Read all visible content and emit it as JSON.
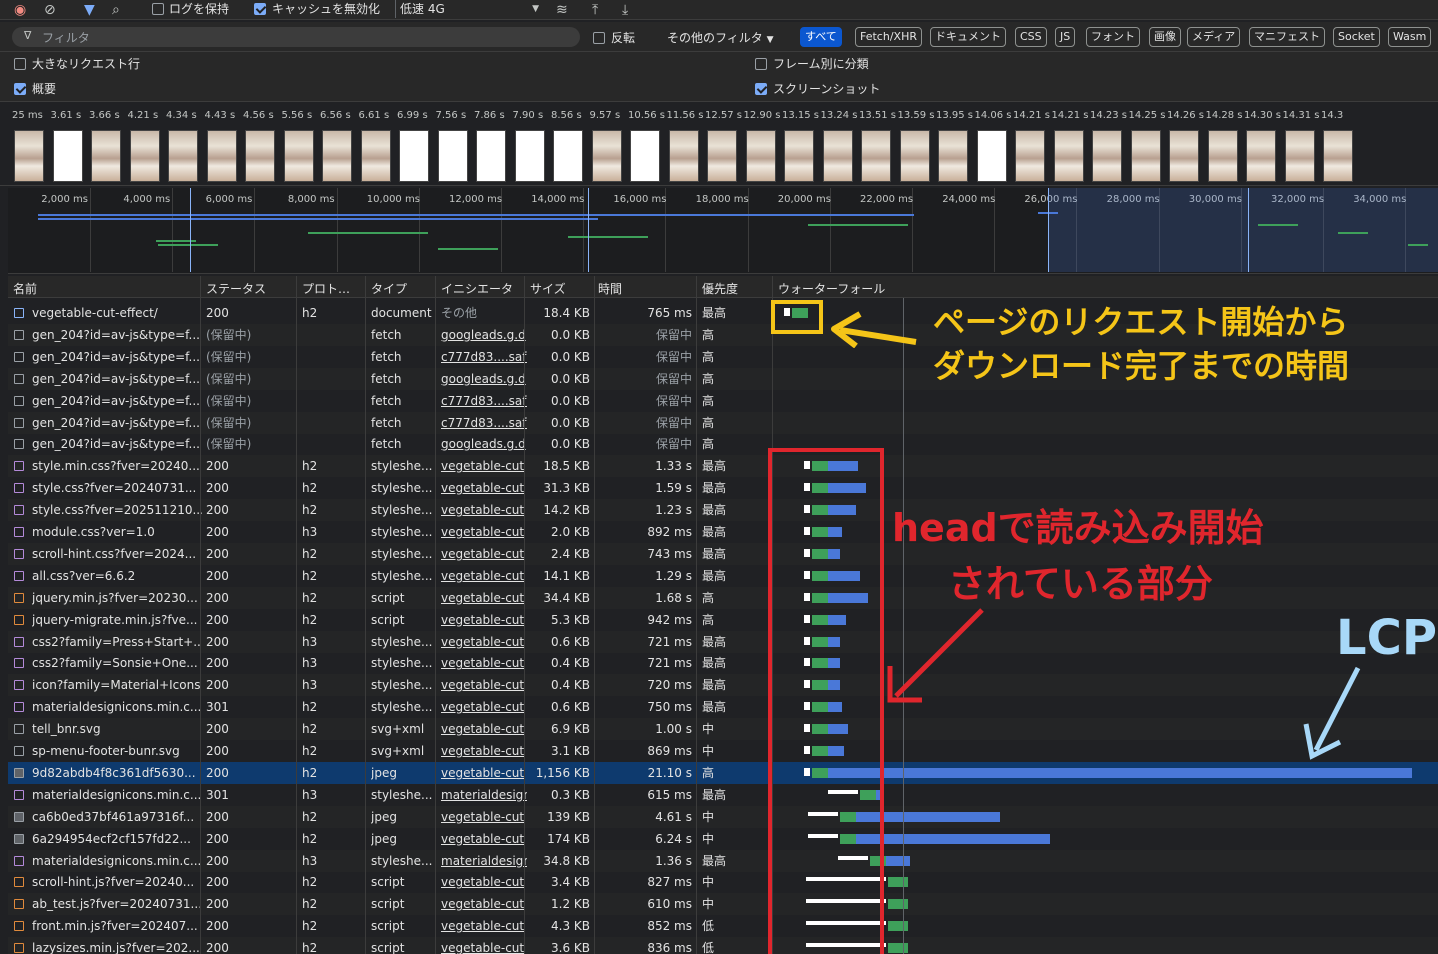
{
  "toolbar": {
    "preserve_log_label": "ログを保持",
    "disable_cache_label": "キャッシュを無効化",
    "throttle_value": "低速 4G"
  },
  "filterbar": {
    "placeholder": "フィルタ",
    "invert_label": "反転",
    "more_filters_label": "その他のフィルタ",
    "types": [
      "すべて",
      "Fetch/XHR",
      "ドキュメント",
      "CSS",
      "JS",
      "フォント",
      "画像",
      "メディア",
      "マニフェスト",
      "Socket",
      "Wasm"
    ]
  },
  "options": {
    "large_rows": "大きなリクエスト行",
    "group_by_frame": "フレーム別に分類",
    "overview": "概要",
    "screenshots": "スクリーンショット"
  },
  "filmstrip_times": [
    "25 ms",
    "3.61 s",
    "3.66 s",
    "4.21 s",
    "4.34 s",
    "4.43 s",
    "4.56 s",
    "5.56 s",
    "6.56 s",
    "6.61 s",
    "6.99 s",
    "7.56 s",
    "7.86 s",
    "7.90 s",
    "8.56 s",
    "9.57 s",
    "10.56 s",
    "11.56 s",
    "12.57 s",
    "12.90 s",
    "13.15 s",
    "13.24 s",
    "13.51 s",
    "13.59 s",
    "13.95 s",
    "14.06 s",
    "14.21 s",
    "14.21 s",
    "14.23 s",
    "14.25 s",
    "14.26 s",
    "14.28 s",
    "14.30 s",
    "14.31 s",
    "14.3"
  ],
  "overview_ticks": [
    "2,000 ms",
    "4,000 ms",
    "6,000 ms",
    "8,000 ms",
    "10,000 ms",
    "12,000 ms",
    "14,000 ms",
    "16,000 ms",
    "18,000 ms",
    "20,000 ms",
    "22,000 ms",
    "24,000 ms",
    "26,000 ms",
    "28,000 ms",
    "30,000 ms",
    "32,000 ms",
    "34,000 ms"
  ],
  "columns": {
    "name": "名前",
    "status": "ステータス",
    "protocol": "プロト…",
    "type": "タイプ",
    "initiator": "イニシエータ",
    "size": "サイズ",
    "time": "時間",
    "priority": "優先度",
    "waterfall": "ウォーターフォール"
  },
  "rows": [
    {
      "name": "vegetable-cut-effect/",
      "status": "200",
      "protocol": "h2",
      "type": "document",
      "initiator": "その他",
      "size": "18.4 KB",
      "time": "765 ms",
      "priority": "最高",
      "icon": "doc"
    },
    {
      "name": "gen_204?id=av-js&type=f...",
      "status": "(保留中)",
      "protocol": "",
      "type": "fetch",
      "initiator": "googleads.g.d",
      "size": "0.0 KB",
      "time": "保留中",
      "priority": "高",
      "icon": "file"
    },
    {
      "name": "gen_204?id=av-js&type=f...",
      "status": "(保留中)",
      "protocol": "",
      "type": "fetch",
      "initiator": "c777d83....safe",
      "size": "0.0 KB",
      "time": "保留中",
      "priority": "高",
      "icon": "file"
    },
    {
      "name": "gen_204?id=av-js&type=f...",
      "status": "(保留中)",
      "protocol": "",
      "type": "fetch",
      "initiator": "googleads.g.d",
      "size": "0.0 KB",
      "time": "保留中",
      "priority": "高",
      "icon": "file"
    },
    {
      "name": "gen_204?id=av-js&type=f...",
      "status": "(保留中)",
      "protocol": "",
      "type": "fetch",
      "initiator": "c777d83....safe",
      "size": "0.0 KB",
      "time": "保留中",
      "priority": "高",
      "icon": "file"
    },
    {
      "name": "gen_204?id=av-js&type=f...",
      "status": "(保留中)",
      "protocol": "",
      "type": "fetch",
      "initiator": "c777d83....safe",
      "size": "0.0 KB",
      "time": "保留中",
      "priority": "高",
      "icon": "file"
    },
    {
      "name": "gen_204?id=av-js&type=f...",
      "status": "(保留中)",
      "protocol": "",
      "type": "fetch",
      "initiator": "googleads.g.d",
      "size": "0.0 KB",
      "time": "保留中",
      "priority": "高",
      "icon": "file"
    },
    {
      "name": "style.min.css?fver=20240...",
      "status": "200",
      "protocol": "h2",
      "type": "styleshe...",
      "initiator": "vegetable-cut",
      "size": "18.5 KB",
      "time": "1.33 s",
      "priority": "最高",
      "icon": "css"
    },
    {
      "name": "style.css?fver=20240731...",
      "status": "200",
      "protocol": "h2",
      "type": "styleshe...",
      "initiator": "vegetable-cut",
      "size": "31.3 KB",
      "time": "1.59 s",
      "priority": "最高",
      "icon": "css"
    },
    {
      "name": "style.css?fver=202511210...",
      "status": "200",
      "protocol": "h2",
      "type": "styleshe...",
      "initiator": "vegetable-cut",
      "size": "14.2 KB",
      "time": "1.23 s",
      "priority": "最高",
      "icon": "css"
    },
    {
      "name": "module.css?ver=1.0",
      "status": "200",
      "protocol": "h3",
      "type": "styleshe...",
      "initiator": "vegetable-cut",
      "size": "2.0 KB",
      "time": "892 ms",
      "priority": "最高",
      "icon": "css"
    },
    {
      "name": "scroll-hint.css?fver=2024...",
      "status": "200",
      "protocol": "h2",
      "type": "styleshe...",
      "initiator": "vegetable-cut",
      "size": "2.4 KB",
      "time": "743 ms",
      "priority": "最高",
      "icon": "css"
    },
    {
      "name": "all.css?ver=6.6.2",
      "status": "200",
      "protocol": "h2",
      "type": "styleshe...",
      "initiator": "vegetable-cut",
      "size": "14.1 KB",
      "time": "1.29 s",
      "priority": "最高",
      "icon": "css"
    },
    {
      "name": "jquery.min.js?fver=20230...",
      "status": "200",
      "protocol": "h2",
      "type": "script",
      "initiator": "vegetable-cut",
      "size": "34.4 KB",
      "time": "1.68 s",
      "priority": "高",
      "icon": "js"
    },
    {
      "name": "jquery-migrate.min.js?fve...",
      "status": "200",
      "protocol": "h2",
      "type": "script",
      "initiator": "vegetable-cut",
      "size": "5.3 KB",
      "time": "942 ms",
      "priority": "高",
      "icon": "js"
    },
    {
      "name": "css2?family=Press+Start+...",
      "status": "200",
      "protocol": "h3",
      "type": "styleshe...",
      "initiator": "vegetable-cut",
      "size": "0.6 KB",
      "time": "721 ms",
      "priority": "最高",
      "icon": "css"
    },
    {
      "name": "css2?family=Sonsie+One...",
      "status": "200",
      "protocol": "h3",
      "type": "styleshe...",
      "initiator": "vegetable-cut",
      "size": "0.4 KB",
      "time": "721 ms",
      "priority": "最高",
      "icon": "css"
    },
    {
      "name": "icon?family=Material+Icons",
      "status": "200",
      "protocol": "h3",
      "type": "styleshe...",
      "initiator": "vegetable-cut",
      "size": "0.4 KB",
      "time": "720 ms",
      "priority": "最高",
      "icon": "css"
    },
    {
      "name": "materialdesignicons.min.c...",
      "status": "301",
      "protocol": "h2",
      "type": "styleshe...",
      "initiator": "vegetable-cut",
      "size": "0.6 KB",
      "time": "750 ms",
      "priority": "最高",
      "icon": "css"
    },
    {
      "name": "tell_bnr.svg",
      "status": "200",
      "protocol": "h2",
      "type": "svg+xml",
      "initiator": "vegetable-cut",
      "size": "6.9 KB",
      "time": "1.00 s",
      "priority": "中",
      "icon": "svg"
    },
    {
      "name": "sp-menu-footer-bunr.svg",
      "status": "200",
      "protocol": "h2",
      "type": "svg+xml",
      "initiator": "vegetable-cut",
      "size": "3.1 KB",
      "time": "869 ms",
      "priority": "中",
      "icon": "svg"
    },
    {
      "name": "9d82abdb4f8c361df5630...",
      "status": "200",
      "protocol": "h2",
      "type": "jpeg",
      "initiator": "vegetable-cut",
      "size": "1,156 KB",
      "time": "21.10 s",
      "priority": "高",
      "icon": "img",
      "selected": true
    },
    {
      "name": "materialdesignicons.min.c...",
      "status": "301",
      "protocol": "h3",
      "type": "styleshe...",
      "initiator": "materialdesign",
      "size": "0.3 KB",
      "time": "615 ms",
      "priority": "最高",
      "icon": "css"
    },
    {
      "name": "ca6b0ed37bf461a97316f...",
      "status": "200",
      "protocol": "h2",
      "type": "jpeg",
      "initiator": "vegetable-cut",
      "size": "139 KB",
      "time": "4.61 s",
      "priority": "中",
      "icon": "img"
    },
    {
      "name": "6a294954ecf2cf157fd22...",
      "status": "200",
      "protocol": "h2",
      "type": "jpeg",
      "initiator": "vegetable-cut",
      "size": "174 KB",
      "time": "6.24 s",
      "priority": "中",
      "icon": "img"
    },
    {
      "name": "materialdesignicons.min.c...",
      "status": "200",
      "protocol": "h3",
      "type": "styleshe...",
      "initiator": "materialdesign",
      "size": "34.8 KB",
      "time": "1.36 s",
      "priority": "最高",
      "icon": "css"
    },
    {
      "name": "scroll-hint.js?fver=20240...",
      "status": "200",
      "protocol": "h2",
      "type": "script",
      "initiator": "vegetable-cut",
      "size": "3.4 KB",
      "time": "827 ms",
      "priority": "中",
      "icon": "js"
    },
    {
      "name": "ab_test.js?fver=20240731...",
      "status": "200",
      "protocol": "h2",
      "type": "script",
      "initiator": "vegetable-cut",
      "size": "1.2 KB",
      "time": "610 ms",
      "priority": "中",
      "icon": "js"
    },
    {
      "name": "front.min.js?fver=202407...",
      "status": "200",
      "protocol": "h2",
      "type": "script",
      "initiator": "vegetable-cut",
      "size": "4.3 KB",
      "time": "852 ms",
      "priority": "低",
      "icon": "js"
    },
    {
      "name": "lazysizes.min.js?fver=202...",
      "status": "200",
      "protocol": "h2",
      "type": "script",
      "initiator": "vegetable-cut",
      "size": "3.6 KB",
      "time": "836 ms",
      "priority": "低",
      "icon": "js"
    }
  ],
  "annotations": {
    "yellow_note_line1": "ページのリクエスト開始から",
    "yellow_note_line2": "ダウンロード完了までの時間",
    "red_note_line1": "headで読み込み開始",
    "red_note_line2": "されている部分",
    "lcp_label": "LCP"
  },
  "colors": {
    "accent": "#0b57d0",
    "annotation_yellow": "#f5c518",
    "annotation_red": "#e0262d",
    "annotation_blue": "#a8d8f8",
    "bar_blue": "#4a78d8",
    "bar_green": "#3ea05a"
  }
}
